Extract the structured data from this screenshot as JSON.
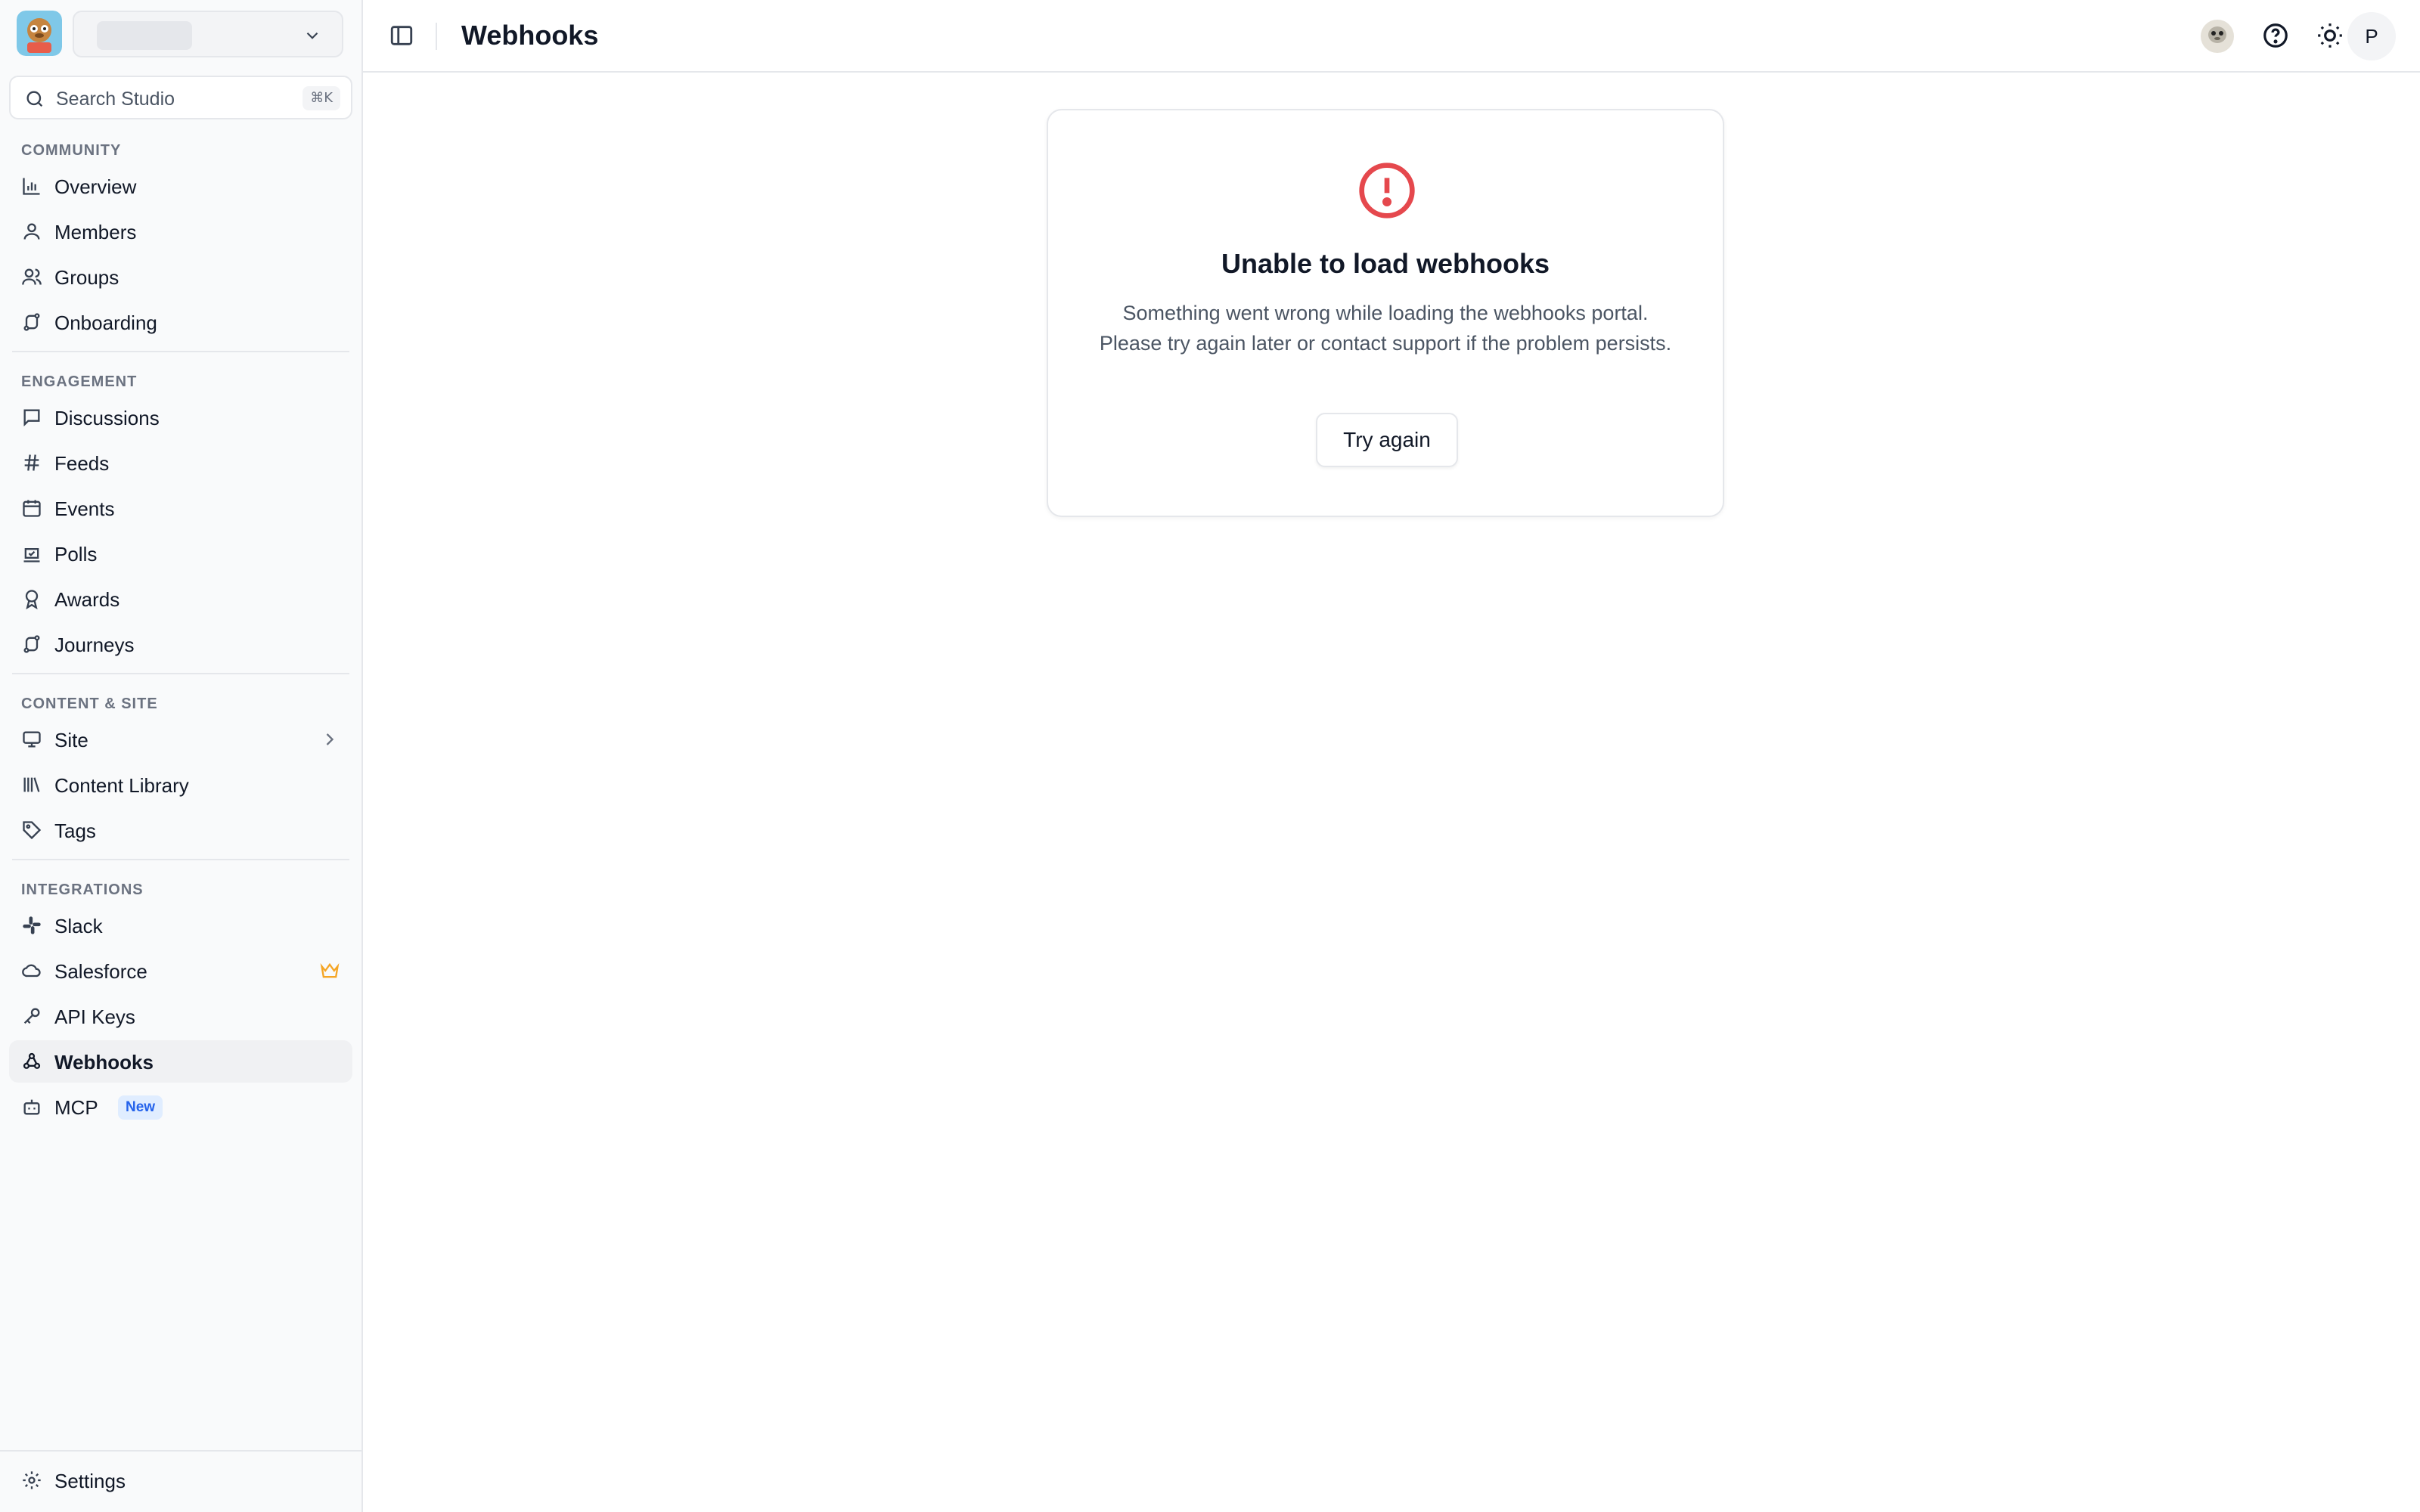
{
  "header": {
    "title": "Webhooks"
  },
  "search": {
    "placeholder": "Search Studio",
    "shortcut": "⌘K"
  },
  "sections": {
    "community": "COMMUNITY",
    "engagement": "ENGAGEMENT",
    "content": "CONTENT & SITE",
    "integrations": "INTEGRATIONS"
  },
  "nav": {
    "overview": "Overview",
    "members": "Members",
    "groups": "Groups",
    "onboarding": "Onboarding",
    "discussions": "Discussions",
    "feeds": "Feeds",
    "events": "Events",
    "polls": "Polls",
    "awards": "Awards",
    "journeys": "Journeys",
    "site": "Site",
    "content_library": "Content Library",
    "tags": "Tags",
    "slack": "Slack",
    "salesforce": "Salesforce",
    "api_keys": "API Keys",
    "webhooks": "Webhooks",
    "mcp": "MCP",
    "mcp_badge": "New",
    "settings": "Settings"
  },
  "user": {
    "initial": "P"
  },
  "error": {
    "title": "Unable to load webhooks",
    "message": "Something went wrong while loading the webhooks portal. Please try again later or contact support if the problem persists.",
    "retry_label": "Try again"
  },
  "colors": {
    "error": "#e5484d",
    "crown": "#f5a524",
    "badge": "#2563eb"
  }
}
